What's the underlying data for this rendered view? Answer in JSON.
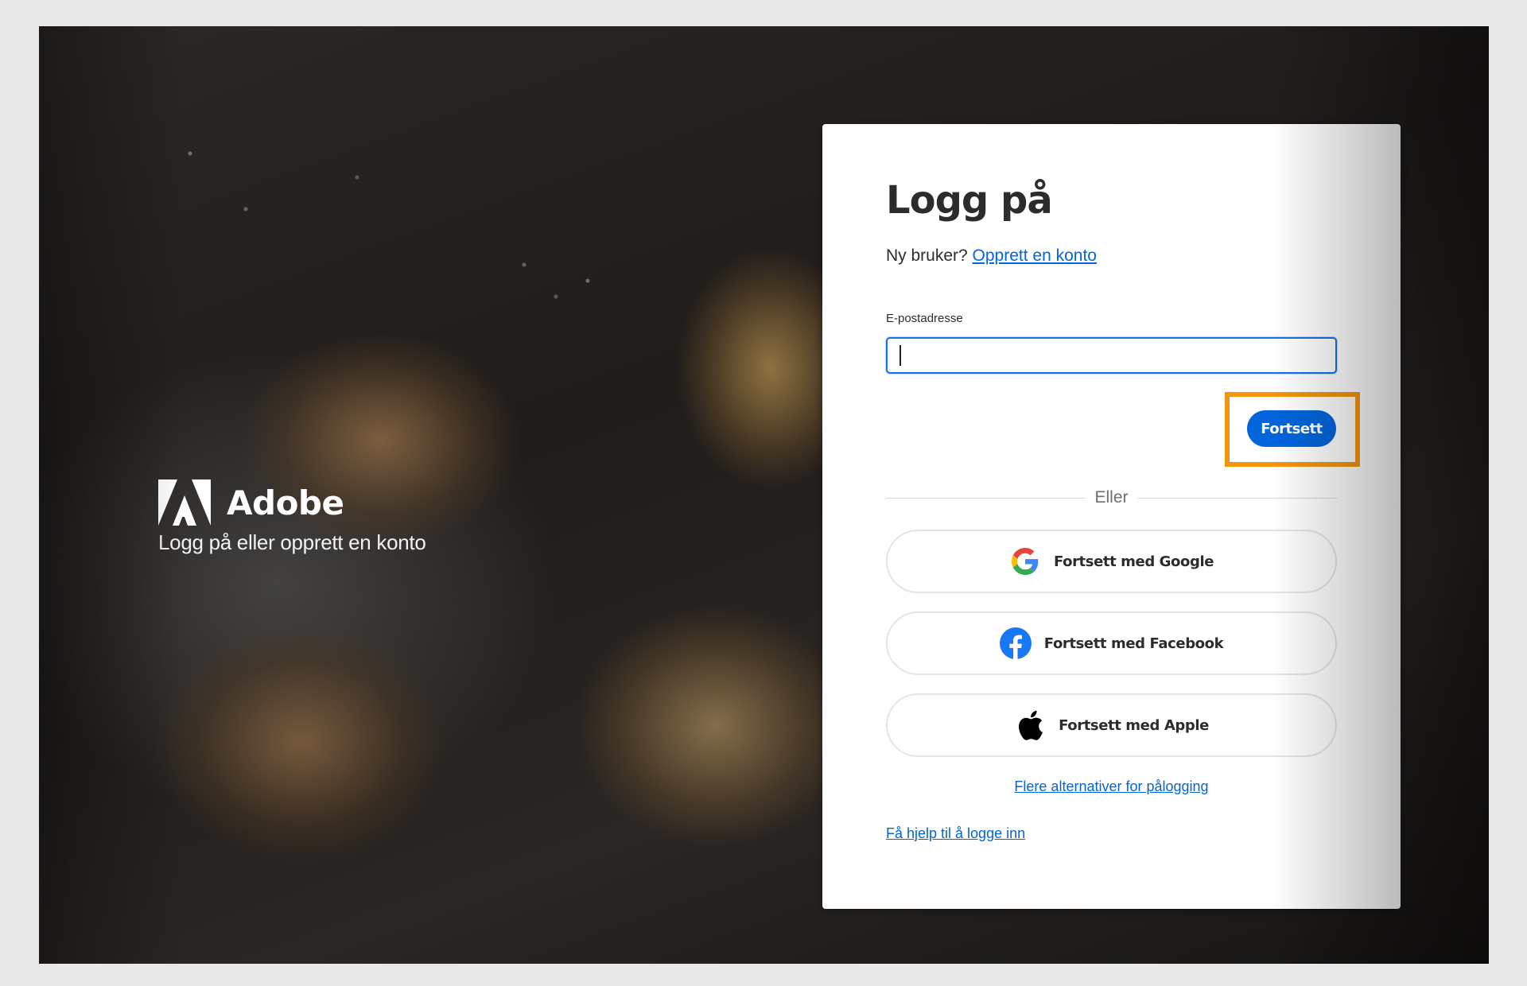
{
  "brand": {
    "name": "Adobe",
    "tagline": "Logg på eller opprett en konto",
    "icon": "adobe-logo-icon"
  },
  "login": {
    "title": "Logg på",
    "new_user_text": "Ny bruker?",
    "create_account_link": "Opprett en konto",
    "email_label": "E-postadresse",
    "email_value": "",
    "continue_label": "Fortsett",
    "divider_text": "Eller",
    "social": [
      {
        "label": "Fortsett med Google",
        "icon": "google-icon"
      },
      {
        "label": "Fortsett med Facebook",
        "icon": "facebook-icon"
      },
      {
        "label": "Fortsett med Apple",
        "icon": "apple-icon"
      }
    ],
    "more_options_link": "Flere alternativer for pålogging",
    "help_link": "Få hjelp til å logge inn"
  },
  "colors": {
    "accent": "#0265dc",
    "highlight": "#f2960f",
    "facebook": "#1877f2",
    "page_background": "#e8e8e8"
  }
}
